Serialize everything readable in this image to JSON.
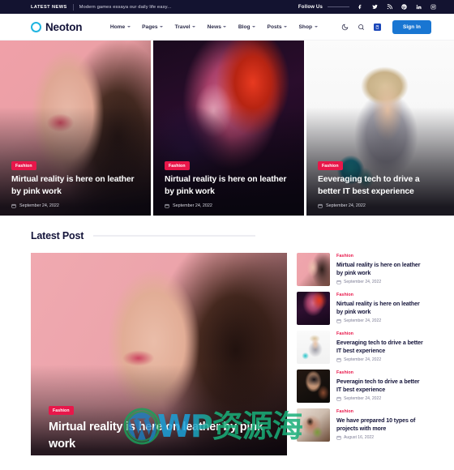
{
  "topbar": {
    "latest_label": "LATEST NEWS",
    "ticker": "Modern games essaya our daily life easy...",
    "follow_label": "Follow Us",
    "socials": [
      "facebook-icon",
      "twitter-icon",
      "rss-icon",
      "pinterest-icon",
      "linkedin-icon",
      "instagram-icon"
    ]
  },
  "nav": {
    "brand": "Neoton",
    "items": [
      {
        "label": "Home",
        "caret": true
      },
      {
        "label": "Pages",
        "caret": true
      },
      {
        "label": "Travel",
        "caret": true
      },
      {
        "label": "News",
        "caret": true
      },
      {
        "label": "Blog",
        "caret": true
      },
      {
        "label": "Posts",
        "caret": true
      },
      {
        "label": "Shop",
        "caret": true
      }
    ],
    "icons": [
      "dark-mode-icon",
      "search-icon",
      "cart-icon"
    ],
    "signin_label": "Sign In"
  },
  "hero": [
    {
      "category": "Fashion",
      "title": "Mirtual reality is here on leather by pink work",
      "date": "September 24, 2022"
    },
    {
      "category": "Fashion",
      "title": "Nirtual reality is here on leather by pink work",
      "date": "September 24, 2022"
    },
    {
      "category": "Fashion",
      "title": "Eeveraging tech to drive a better IT best experience",
      "date": "September 24, 2022"
    }
  ],
  "latest": {
    "section_title": "Latest Post",
    "feature": {
      "category": "Fashion",
      "title": "Mirtual reality is here on leather by pink work"
    },
    "items": [
      {
        "category": "Fashion",
        "title": "Mirtual reality is here on leather by pink work",
        "date": "September 24, 2022"
      },
      {
        "category": "Fashion",
        "title": "Nirtual reality is here on leather by pink work",
        "date": "September 24, 2022"
      },
      {
        "category": "Fashion",
        "title": "Eeveraging tech to drive a better IT best experience",
        "date": "September 24, 2022"
      },
      {
        "category": "Fashion",
        "title": "Peveragin tech to drive a better IT best experience",
        "date": "September 24, 2022"
      },
      {
        "category": "Fashion",
        "title": "We have prepared 10 types of projects with more",
        "date": "August 16, 2022"
      }
    ]
  },
  "watermark": {
    "text": "WP资源海"
  },
  "colors": {
    "topbar_bg": "#131330",
    "brand_accent": "#20b5e0",
    "badge": "#e8174a",
    "signin": "#1976d2",
    "heading": "#14143a"
  }
}
